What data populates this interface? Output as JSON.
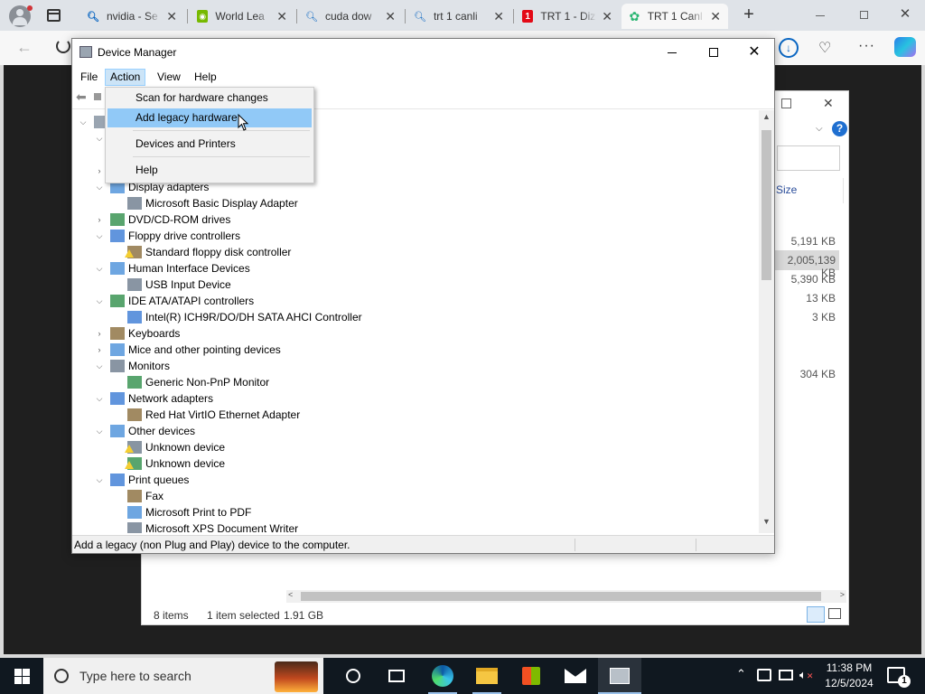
{
  "browser": {
    "tabs": [
      {
        "label": "nvidia - Se",
        "icon": "search-icon"
      },
      {
        "label": "World Lea",
        "icon": "nvidia-icon"
      },
      {
        "label": "cuda dow",
        "icon": "search-icon"
      },
      {
        "label": "trt 1 canli",
        "icon": "search-icon"
      },
      {
        "label": "TRT 1 - Diz",
        "icon": "trt-icon"
      },
      {
        "label": "TRT 1 Canl",
        "icon": "trt-live-icon"
      }
    ]
  },
  "explorer": {
    "size_header": "Size",
    "sizes": [
      "5,191 KB",
      "2,005,139 KB",
      "5,390 KB",
      "13 KB",
      "3 KB",
      "304 KB"
    ],
    "status_items": "8 items",
    "status_selected": "1 item selected",
    "status_size": "1.91 GB"
  },
  "device_manager": {
    "title": "Device Manager",
    "menu": [
      "File",
      "Action",
      "View",
      "Help"
    ],
    "status": "Add a legacy (non Plug and Play) device to the computer.",
    "action_menu": {
      "items": [
        "Scan for hardware changes",
        "Add legacy hardware",
        "Devices and Printers",
        "Help"
      ]
    },
    "tree": [
      {
        "label": "Display adapters",
        "level": 1,
        "expanded": true
      },
      {
        "label": "Microsoft Basic Display Adapter",
        "level": 2
      },
      {
        "label": "DVD/CD-ROM drives",
        "level": 1,
        "expanded": false
      },
      {
        "label": "Floppy drive controllers",
        "level": 1,
        "expanded": true
      },
      {
        "label": "Standard floppy disk controller",
        "level": 2,
        "warning": true
      },
      {
        "label": "Human Interface Devices",
        "level": 1,
        "expanded": true
      },
      {
        "label": "USB Input Device",
        "level": 2
      },
      {
        "label": "IDE ATA/ATAPI controllers",
        "level": 1,
        "expanded": true
      },
      {
        "label": "Intel(R) ICH9R/DO/DH SATA AHCI Controller",
        "level": 2
      },
      {
        "label": "Keyboards",
        "level": 1,
        "expanded": false
      },
      {
        "label": "Mice and other pointing devices",
        "level": 1,
        "expanded": false
      },
      {
        "label": "Monitors",
        "level": 1,
        "expanded": true
      },
      {
        "label": "Generic Non-PnP Monitor",
        "level": 2
      },
      {
        "label": "Network adapters",
        "level": 1,
        "expanded": true
      },
      {
        "label": "Red Hat VirtIO Ethernet Adapter",
        "level": 2
      },
      {
        "label": "Other devices",
        "level": 1,
        "expanded": true
      },
      {
        "label": "Unknown device",
        "level": 2,
        "warning": true
      },
      {
        "label": "Unknown device",
        "level": 2,
        "warning": true
      },
      {
        "label": "Print queues",
        "level": 1,
        "expanded": true
      },
      {
        "label": "Fax",
        "level": 2
      },
      {
        "label": "Microsoft Print to PDF",
        "level": 2
      },
      {
        "label": "Microsoft XPS Document Writer",
        "level": 2
      }
    ]
  },
  "taskbar": {
    "search_placeholder": "Type here to search",
    "time": "11:38 PM",
    "date": "12/5/2024",
    "notification_count": "1"
  }
}
